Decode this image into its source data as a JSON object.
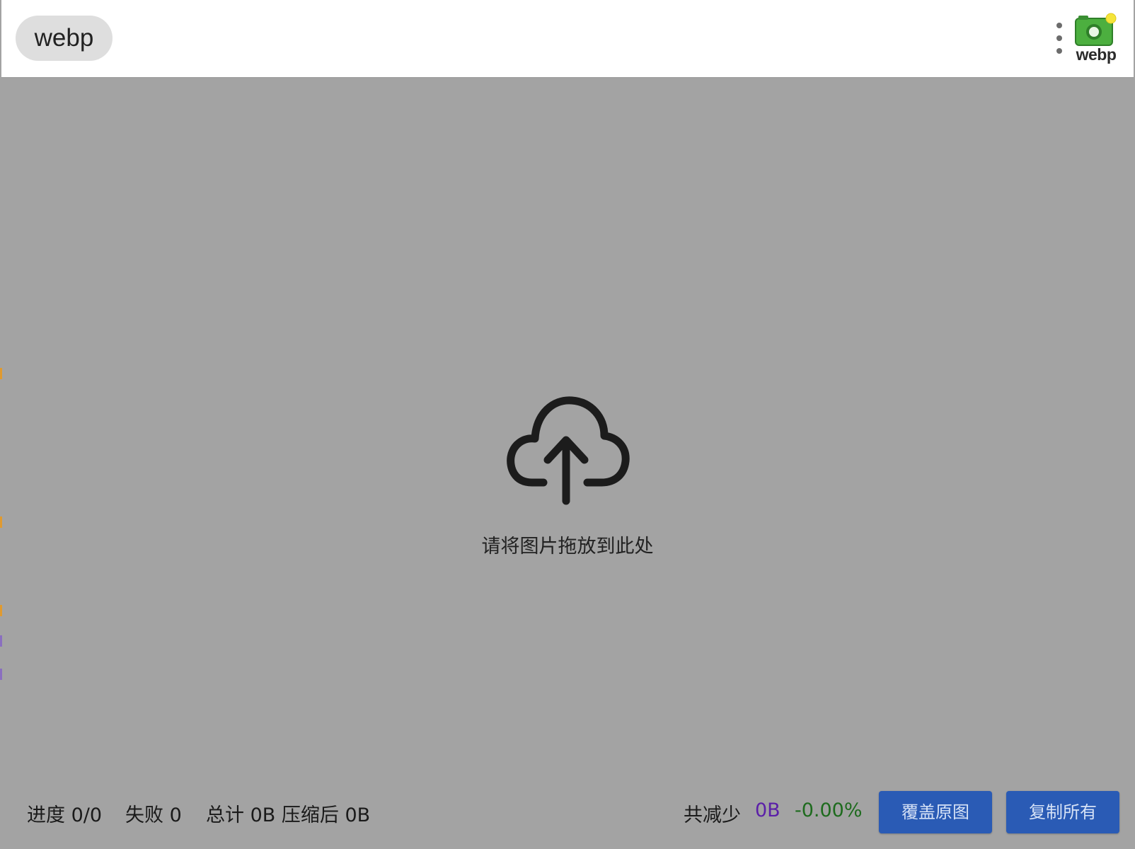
{
  "header": {
    "mode_chip": "webp",
    "logo_label": "webp",
    "more_menu_icon": "more-vertical-icon",
    "logo_icon": "camera-icon"
  },
  "dropzone": {
    "icon": "cloud-upload-icon",
    "hint": "请将图片拖放到此处"
  },
  "footer": {
    "progress": "进度 0/0",
    "failed": "失败 0",
    "total": "总计 0B 压缩后 0B",
    "saved_label": "共减少",
    "saved_bytes": "0B",
    "saved_percent": "-0.00%",
    "overwrite_button": "覆盖原图",
    "copy_all_button": "复制所有"
  },
  "colors": {
    "header_bg": "#ffffff",
    "dropzone_bg": "#a3a3a3",
    "button_bg": "#2a5bb5",
    "button_text": "#d6e2f6",
    "saved_bytes": "#5b1fa8",
    "saved_percent": "#1e6b1e",
    "logo_green": "#3fa33a"
  }
}
